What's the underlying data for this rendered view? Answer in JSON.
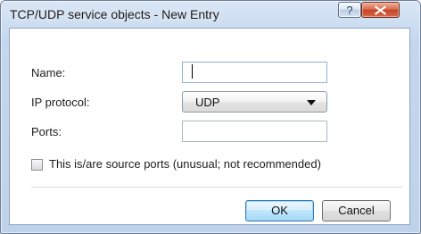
{
  "window": {
    "title": "TCP/UDP service objects - New Entry",
    "help_label": "?",
    "close_label": "×"
  },
  "form": {
    "name_label": "Name:",
    "name_value": "",
    "ip_protocol_label": "IP protocol:",
    "ip_protocol_value": "UDP",
    "ports_label": "Ports:",
    "ports_value": "",
    "source_ports_label": "This is/are source ports (unusual; not recommended)",
    "source_ports_checked": false
  },
  "actions": {
    "ok_label": "OK",
    "cancel_label": "Cancel"
  },
  "icons": {
    "help": "question-mark-icon",
    "close": "close-icon",
    "dropdown": "chevron-down-icon"
  },
  "colors": {
    "title_bar": "#c5d7ee",
    "close_button": "#c54428",
    "ok_button": "#bee6fd"
  }
}
